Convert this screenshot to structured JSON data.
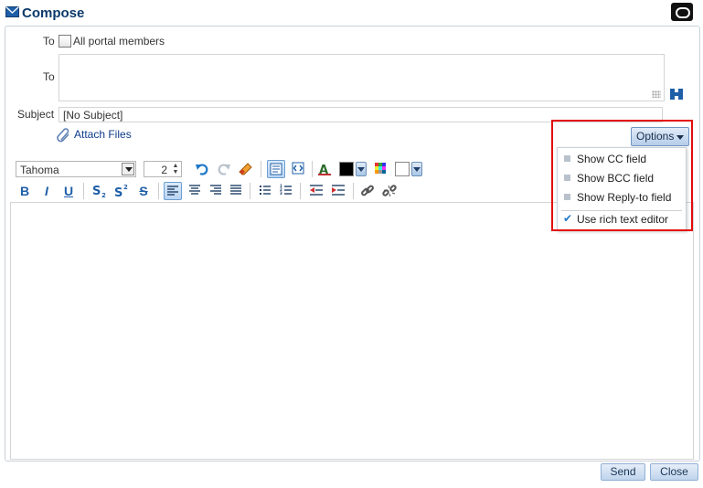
{
  "window": {
    "title": "Compose"
  },
  "recipients": {
    "to_label_1": "To",
    "all_members_label": "All portal members",
    "all_members_checked": false,
    "to_label_2": "To",
    "to_value": ""
  },
  "subject": {
    "label": "Subject",
    "value": "[No Subject]"
  },
  "attach": {
    "label": "Attach Files"
  },
  "toolbar": {
    "font_family": "Tahoma",
    "font_size": "2",
    "bold": "B",
    "italic": "I",
    "underline": "U",
    "strike": "S",
    "text_color": "#000000",
    "background_color": "#ffffff"
  },
  "options": {
    "button_label": "Options",
    "items": [
      {
        "label": "Show CC field",
        "checked": false
      },
      {
        "label": "Show BCC field",
        "checked": false
      },
      {
        "label": "Show Reply-to field",
        "checked": false
      },
      {
        "label": "Use rich text editor",
        "checked": true
      }
    ]
  },
  "footer": {
    "send_label": "Send",
    "close_label": "Close"
  },
  "colors": {
    "accent": "#1f5fa8",
    "highlight": "#e30c0c",
    "title": "#0d3a6b"
  }
}
